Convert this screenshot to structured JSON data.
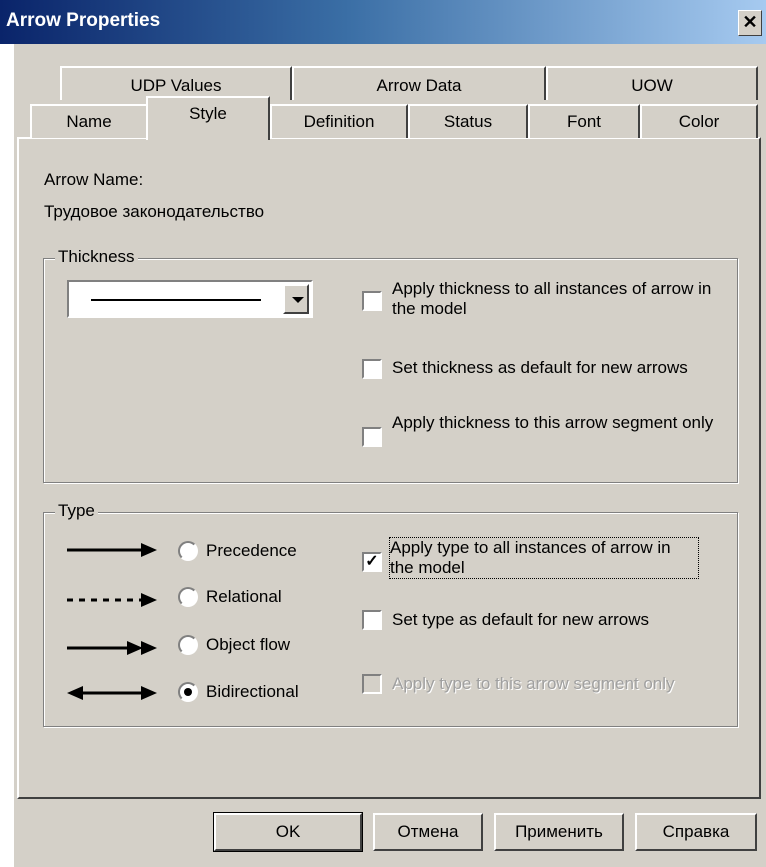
{
  "window": {
    "title": "Arrow Properties",
    "close_glyph": "✕"
  },
  "tabs": {
    "row_back": [
      "UDP Values",
      "Arrow Data",
      "UOW"
    ],
    "row_front": [
      "Name",
      "Style",
      "Definition",
      "Status",
      "Font",
      "Color"
    ],
    "active": "Style"
  },
  "arrow_name": {
    "label": "Arrow Name:",
    "value": "Трудовое законодательство"
  },
  "thickness": {
    "legend": "Thickness",
    "options": [
      {
        "label": "Apply thickness to all instances of arrow in the model",
        "checked": false
      },
      {
        "label": "Set thickness as default for new arrows",
        "checked": false
      },
      {
        "label": "Apply thickness to this arrow segment only",
        "checked": false
      }
    ]
  },
  "type": {
    "legend": "Type",
    "radios": [
      {
        "label": "Precedence",
        "selected": false,
        "arrow_icon": "solid-arrow-icon"
      },
      {
        "label": "Relational",
        "selected": false,
        "arrow_icon": "dashed-arrow-icon"
      },
      {
        "label": "Object flow",
        "selected": false,
        "arrow_icon": "double-head-arrow-icon"
      },
      {
        "label": "Bidirectional",
        "selected": true,
        "arrow_icon": "bidirectional-arrow-icon"
      }
    ],
    "options": [
      {
        "label": "Apply type to all instances of arrow in the model",
        "checked": true,
        "enabled": true
      },
      {
        "label": "Set type as default for new arrows",
        "checked": false,
        "enabled": true
      },
      {
        "label": "Apply type to this arrow segment only",
        "checked": false,
        "enabled": false
      }
    ]
  },
  "buttons": {
    "ok": "OK",
    "cancel": "Отмена",
    "apply": "Применить",
    "help": "Справка"
  }
}
